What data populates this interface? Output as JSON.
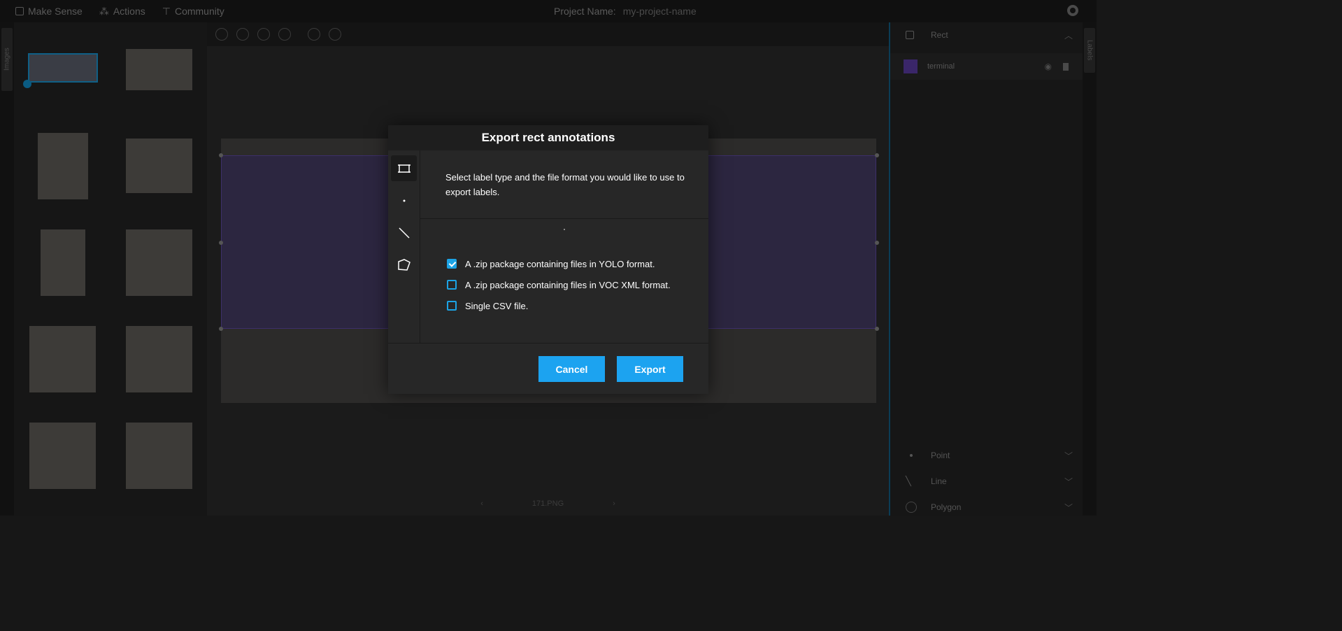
{
  "topbar": {
    "app_name": "Make Sense",
    "actions": "Actions",
    "community": "Community",
    "project_label": "Project Name:",
    "project_value": "my-project-name"
  },
  "left_tab": "Images",
  "right_tab": "Labels",
  "editor": {
    "image_name": "171.PNG"
  },
  "right_panel": {
    "rect_header": "Rect",
    "label_name": "terminal",
    "label_color": "#3a2669",
    "point_header": "Point",
    "line_header": "Line",
    "polygon_header": "Polygon"
  },
  "modal": {
    "title": "Export rect annotations",
    "description": "Select label type and the file format you would like to use to export labels.",
    "options": [
      {
        "label": "A .zip package containing files in YOLO format.",
        "checked": true
      },
      {
        "label": "A .zip package containing files in VOC XML format.",
        "checked": false
      },
      {
        "label": "Single CSV file.",
        "checked": false
      }
    ],
    "cancel_label": "Cancel",
    "export_label": "Export"
  },
  "colors": {
    "accent": "#1ca3f0",
    "modal_bg": "#272727",
    "header_bg": "#1e1e1e"
  }
}
